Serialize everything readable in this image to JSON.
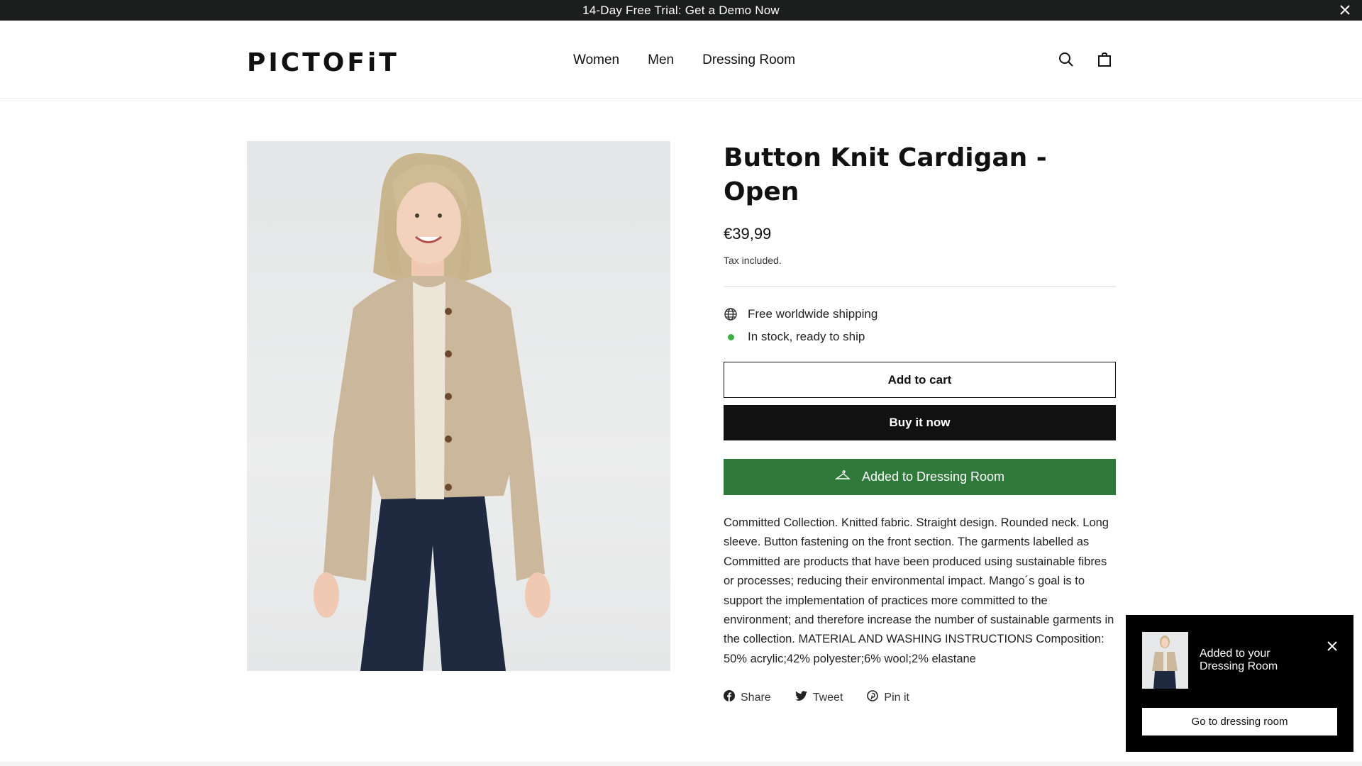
{
  "announcement": {
    "text": "14-Day Free Trial: Get a Demo Now",
    "close_icon": "close-icon"
  },
  "header": {
    "logo": "PICTOFiT",
    "nav": [
      {
        "label": "Women"
      },
      {
        "label": "Men"
      },
      {
        "label": "Dressing Room"
      }
    ],
    "icons": [
      "search-icon",
      "shopping-bag-icon"
    ]
  },
  "product": {
    "title": "Button Knit Cardigan - Open",
    "price": "€39,99",
    "tax_note": "Tax included.",
    "features": [
      {
        "icon": "globe-icon",
        "text": "Free worldwide shipping"
      },
      {
        "icon": "in-stock-dot",
        "text": "In stock, ready to ship",
        "color": "#3cb043"
      }
    ],
    "buttons": {
      "add_to_cart": "Add to cart",
      "buy_now": "Buy it now",
      "dressing_room": "Added to Dressing Room"
    },
    "description": "Committed Collection. Knitted fabric. Straight design. Rounded neck. Long sleeve. Button fastening on the front section. The garments labelled as Committed are products that have been produced using sustainable fibres or processes; reducing their environmental impact. Mango´s goal is to support the implementation of practices more committed to the environment; and therefore increase the number of sustainable garments in the collection. MATERIAL AND WASHING INSTRUCTIONS Composition: 50% acrylic;42% polyester;6% wool;2% elastane",
    "share": [
      {
        "icon": "facebook-icon",
        "label": "Share"
      },
      {
        "icon": "twitter-icon",
        "label": "Tweet"
      },
      {
        "icon": "pinterest-icon",
        "label": "Pin it"
      }
    ]
  },
  "toast": {
    "message": "Added to your Dressing Room",
    "button": "Go to dressing room"
  },
  "colors": {
    "announcement_bg": "#1c1e1d",
    "dressing_room_green": "#2f7a3a",
    "in_stock_green": "#3cb043",
    "buy_button_bg": "#111111",
    "toast_bg": "#000000"
  }
}
